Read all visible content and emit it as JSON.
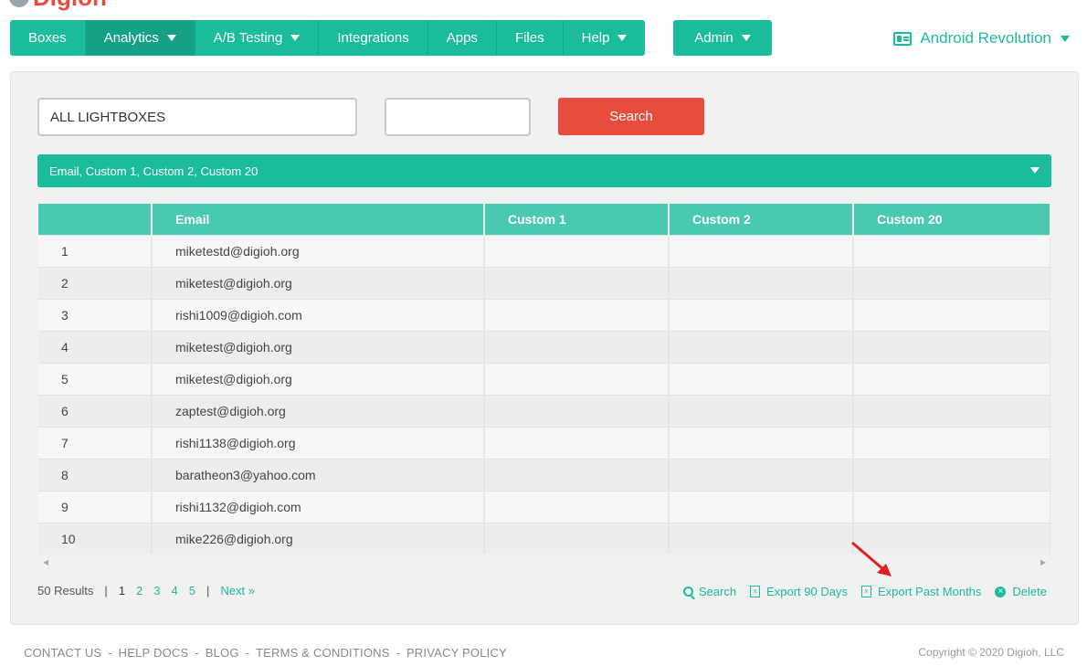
{
  "brand": {
    "name": "Digioh",
    "accent": "#1abc9c",
    "danger": "#e74c3c"
  },
  "nav": {
    "items": [
      {
        "label": "Boxes",
        "dropdown": false
      },
      {
        "label": "Analytics",
        "dropdown": true,
        "active": true
      },
      {
        "label": "A/B Testing",
        "dropdown": true
      },
      {
        "label": "Integrations",
        "dropdown": false
      },
      {
        "label": "Apps",
        "dropdown": false
      },
      {
        "label": "Files",
        "dropdown": false
      },
      {
        "label": "Help",
        "dropdown": true
      }
    ],
    "admin": "Admin"
  },
  "account": {
    "name": "Android Revolution",
    "icon": "id-card-icon"
  },
  "filters": {
    "box_select": "ALL LIGHTBOXES",
    "second_input": "",
    "search_button": "Search",
    "fields": "Email, Custom 1, Custom 2, Custom 20"
  },
  "table": {
    "columns": [
      "",
      "Email",
      "Custom 1",
      "Custom 2",
      "Custom 20"
    ],
    "rows": [
      {
        "n": "1",
        "email": "miketestd@digioh.org"
      },
      {
        "n": "2",
        "email": "miketest@digioh.org"
      },
      {
        "n": "3",
        "email": "rishi1009@digioh.com"
      },
      {
        "n": "4",
        "email": "miketest@digioh.org"
      },
      {
        "n": "5",
        "email": "miketest@digioh.org"
      },
      {
        "n": "6",
        "email": "zaptest@digioh.org"
      },
      {
        "n": "7",
        "email": "rishi1138@digioh.org"
      },
      {
        "n": "8",
        "email": "baratheon3@yahoo.com"
      },
      {
        "n": "9",
        "email": "rishi1132@digioh.com"
      },
      {
        "n": "10",
        "email": "mike226@digioh.org"
      }
    ]
  },
  "pager": {
    "results": "50 Results",
    "sep": "|",
    "pages": [
      "1",
      "2",
      "3",
      "4",
      "5"
    ],
    "current": "1",
    "next": "Next »"
  },
  "actions": {
    "search": "Search",
    "export90": "Export 90 Days",
    "export_past": "Export Past Months",
    "delete": "Delete"
  },
  "footer": {
    "links": [
      "CONTACT US",
      "HELP DOCS",
      "BLOG",
      "TERMS & CONDITIONS",
      "PRIVACY POLICY"
    ],
    "dash": "-",
    "copyright": "Copyright © 2020 Digioh, LLC"
  }
}
